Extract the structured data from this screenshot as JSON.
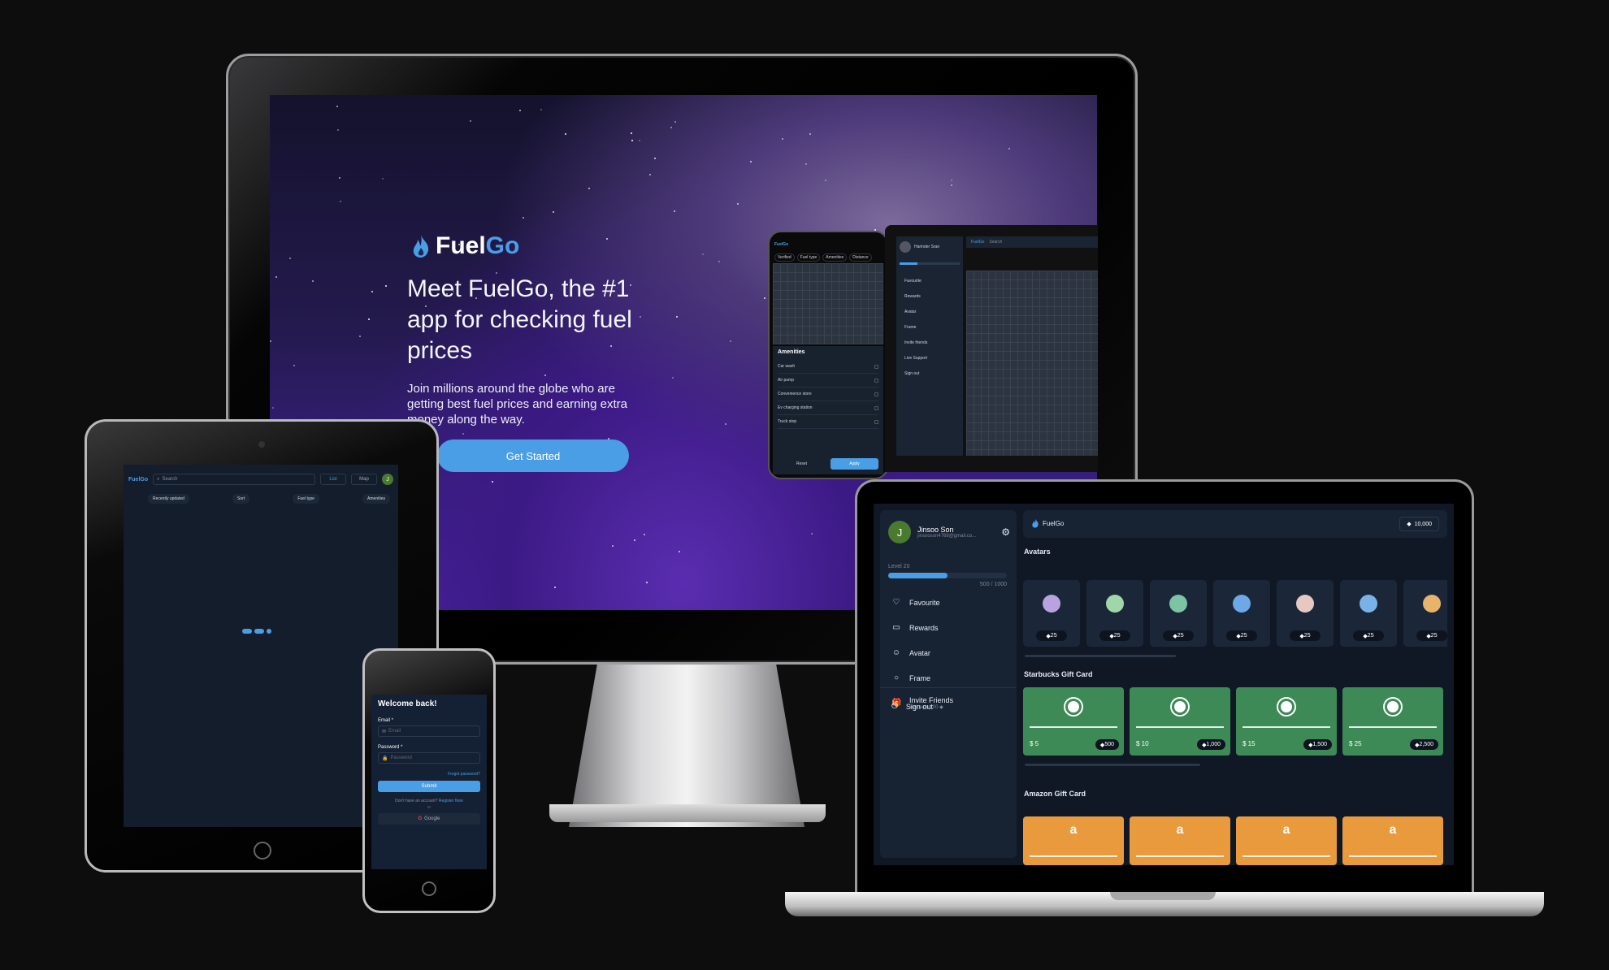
{
  "imac": {
    "brand": {
      "fuel": "Fuel",
      "go": "Go"
    },
    "hero_title": "Meet FuelGo, the #1 app for checking fuel prices",
    "hero_subtitle": "Join millions around the globe who are getting best fuel prices and earning extra money along the way.",
    "cta_label": "Get Started",
    "mini_phone": {
      "filters": [
        "Verified",
        "Fuel type",
        "Amenities",
        "Distance"
      ],
      "amenities_title": "Amenities",
      "amenities": [
        "Car wash",
        "Air pump",
        "Convenience store",
        "Ev charging station",
        "Truck stop"
      ],
      "reset_label": "Reset",
      "apply_label": "Apply"
    },
    "mini_laptop": {
      "user_name": "Harinder Sran",
      "menu": [
        "Favourite",
        "Rewards",
        "Avatar",
        "Frame",
        "Invite friends",
        "Live Support",
        "Sign out"
      ],
      "search_placeholder": "Search"
    }
  },
  "ipad": {
    "brand": "FuelGo",
    "search_placeholder": "Search",
    "list_label": "List",
    "map_label": "Map",
    "avatar_initial": "J",
    "filters": [
      "Recently updated",
      "Sort",
      "Fuel type",
      "Amenities"
    ]
  },
  "iphone": {
    "title": "Welcome back!",
    "email_label": "Email *",
    "email_placeholder": "Email",
    "password_label": "Password *",
    "password_placeholder": "Password",
    "forgot_label": "Forgot password?",
    "submit_label": "Submit",
    "no_account": "Don't have an account?",
    "register_label": "Register Now",
    "or_label": "or",
    "google_label": "Google"
  },
  "macbook": {
    "user": {
      "initial": "J",
      "name": "Jinsoo Son",
      "email": "jinsooson4768@gmail.co..."
    },
    "level_label": "Level 20",
    "xp_text": "500 / 1000",
    "xp_progress": 0.5,
    "nav": [
      {
        "label": "Favourite",
        "icon": "heart-icon"
      },
      {
        "label": "Rewards",
        "icon": "card-icon"
      },
      {
        "label": "Avatar",
        "icon": "smiley-icon"
      },
      {
        "label": "Frame",
        "icon": "circle-icon"
      },
      {
        "label": "Invite Friends",
        "icon": "gift-icon",
        "sub": "You earn 100"
      }
    ],
    "signout_label": "Sign out",
    "brand": "FuelGo",
    "balance": "10,000",
    "avatars_title": "Avatars",
    "avatar_price": "25",
    "avatar_colors": [
      "#b8a3e0",
      "#9fd7a8",
      "#7cc4a4",
      "#6ea8e6",
      "#e6c7c1",
      "#78b3e8",
      "#e8b36a"
    ],
    "starbucks_title": "Starbucks Gift Card",
    "starbucks_cards": [
      {
        "amount": "$ 5",
        "cost": "500"
      },
      {
        "amount": "$ 10",
        "cost": "1,000"
      },
      {
        "amount": "$ 15",
        "cost": "1,500"
      },
      {
        "amount": "$ 25",
        "cost": "2,500"
      }
    ],
    "amazon_title": "Amazon Gift Card",
    "amazon_count": 4
  }
}
